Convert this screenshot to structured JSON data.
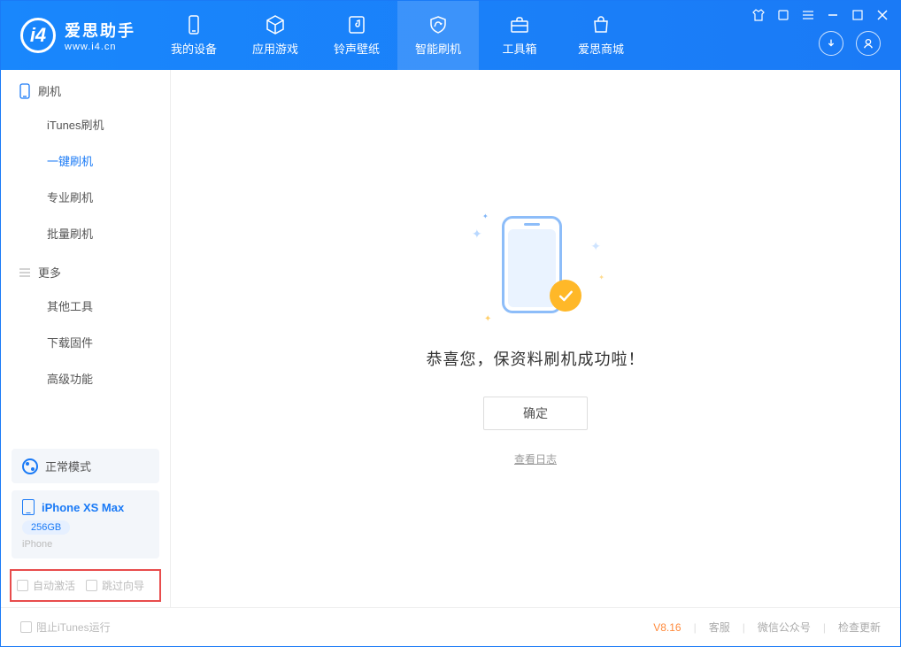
{
  "app": {
    "title": "爱思助手",
    "subtitle": "www.i4.cn"
  },
  "tabs": {
    "device": "我的设备",
    "apps": "应用游戏",
    "ringtones": "铃声壁纸",
    "flash": "智能刷机",
    "toolbox": "工具箱",
    "store": "爱思商城"
  },
  "sidebar": {
    "section_flash": "刷机",
    "items_flash": {
      "itunes": "iTunes刷机",
      "onekey": "一键刷机",
      "pro": "专业刷机",
      "batch": "批量刷机"
    },
    "section_more": "更多",
    "items_more": {
      "other": "其他工具",
      "firmware": "下载固件",
      "advanced": "高级功能"
    },
    "mode": "正常模式",
    "device_name": "iPhone XS Max",
    "device_storage": "256GB",
    "device_type": "iPhone",
    "cb_autoactivate": "自动激活",
    "cb_skipguide": "跳过向导"
  },
  "main": {
    "message": "恭喜您，保资料刷机成功啦！",
    "ok": "确定",
    "view_log": "查看日志"
  },
  "footer": {
    "block_itunes": "阻止iTunes运行",
    "version": "V8.16",
    "support": "客服",
    "wechat": "微信公众号",
    "update": "检查更新"
  }
}
